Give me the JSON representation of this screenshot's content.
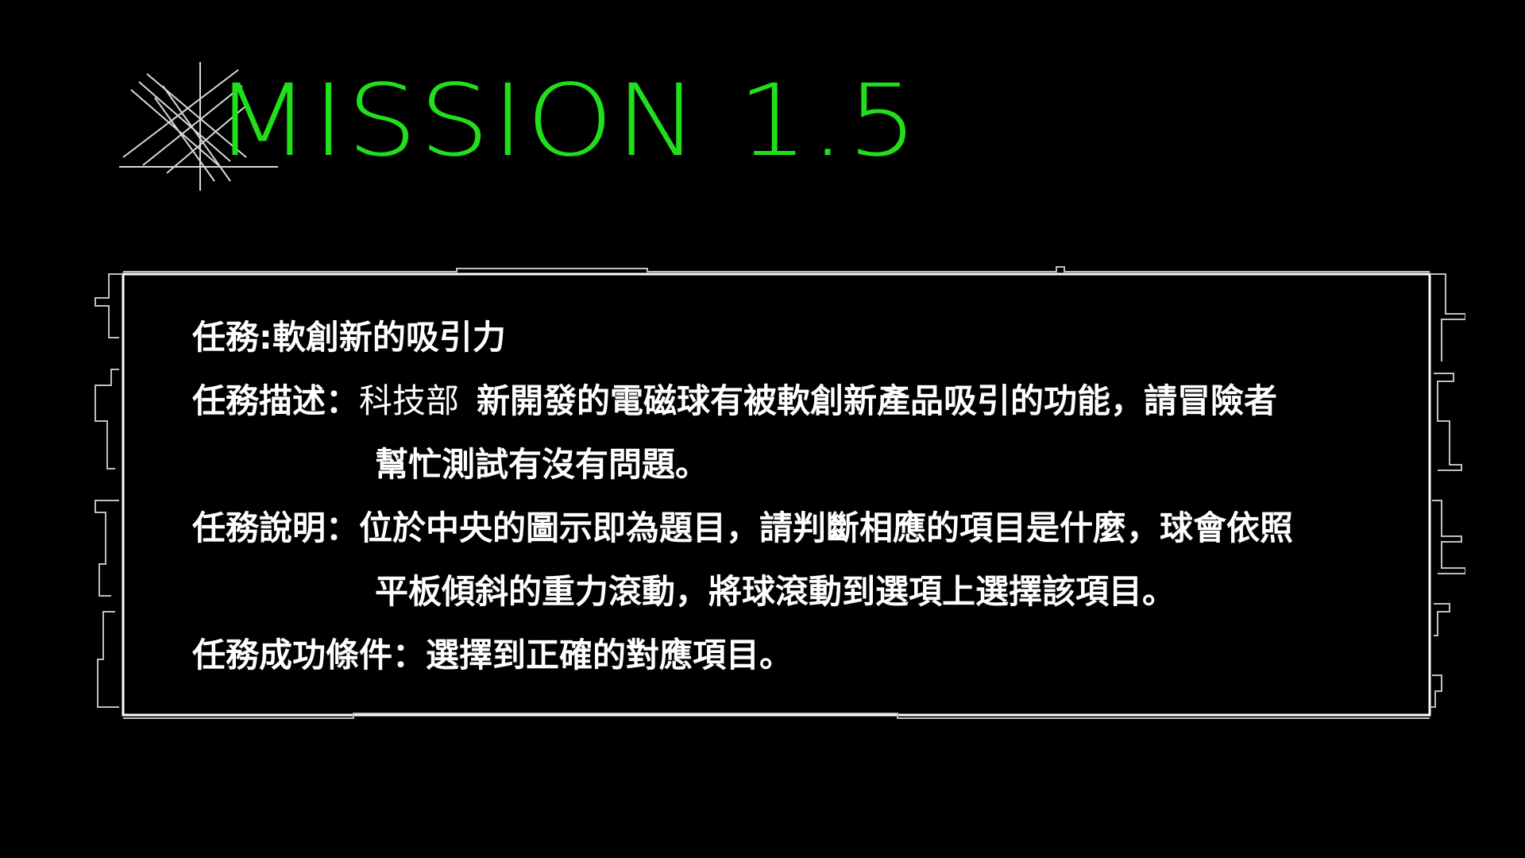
{
  "header": {
    "title": "MISSION 1.5",
    "title_color": "#21e01b",
    "logo_icon": "crosshatch-lines-icon"
  },
  "panel": {
    "rows": [
      {
        "label": "任務",
        "separator": ":",
        "prefix": "",
        "text": "軟創新的吸引力"
      },
      {
        "label": "任務描述",
        "separator": "：",
        "prefix": "科技部",
        "text": "新開發的電磁球有被軟創新產品吸引的功能，請冒險者"
      },
      {
        "label": "",
        "separator": "",
        "prefix": "",
        "text": "幫忙測試有沒有問題。"
      },
      {
        "label": "任務說明",
        "separator": "：",
        "prefix": "",
        "text": "位於中央的圖示即為題目，請判斷相應的項目是什麼，球會依照"
      },
      {
        "label": "",
        "separator": "",
        "prefix": "",
        "text": "平板傾斜的重力滾動，將球滾動到選項上選擇該項目。"
      },
      {
        "label": "任務成功條件",
        "separator": "：",
        "prefix": "",
        "text": "選擇到正確的對應項目。"
      }
    ]
  }
}
